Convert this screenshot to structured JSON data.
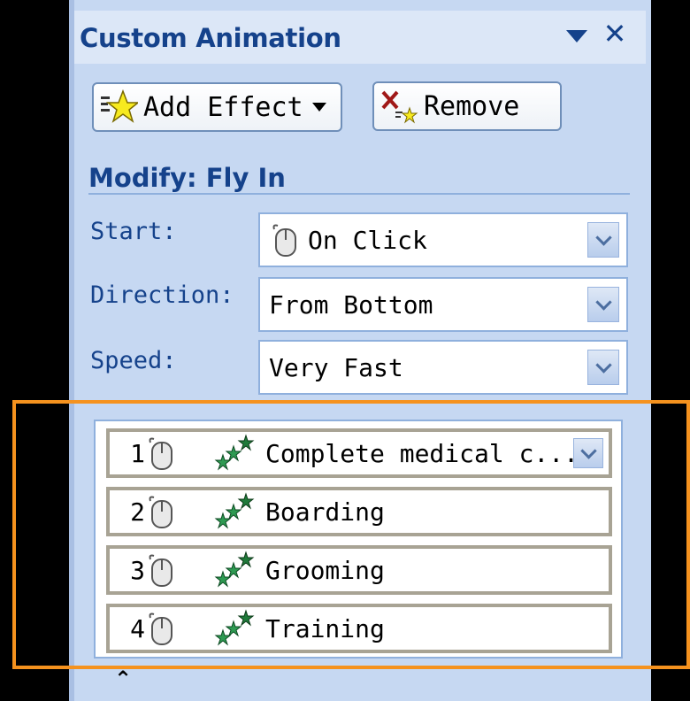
{
  "panel": {
    "title": "Custom Animation"
  },
  "toolbar": {
    "add_effect_label": "Add Effect",
    "remove_label": "Remove"
  },
  "modify": {
    "heading": "Modify: Fly In",
    "start_label": "Start:",
    "start_value": "On Click",
    "direction_label": "Direction:",
    "direction_value": "From Bottom",
    "speed_label": "Speed:",
    "speed_value": "Very Fast"
  },
  "animation_list": {
    "items": [
      {
        "number": "1",
        "label": "Complete medical c...",
        "selected": true
      },
      {
        "number": "2",
        "label": "Boarding"
      },
      {
        "number": "3",
        "label": "Grooming"
      },
      {
        "number": "4",
        "label": "Training"
      }
    ]
  },
  "colors": {
    "title_text": "#15428b",
    "pane_background": "#c6d8f2",
    "highlight": "#f5921e"
  },
  "icons": {
    "add_effect": "star-effect-icon",
    "remove": "remove-x-icon",
    "trigger": "mouse-click-icon",
    "effect": "fly-in-stars-icon",
    "collapse": "double-chevron-up-icon"
  }
}
